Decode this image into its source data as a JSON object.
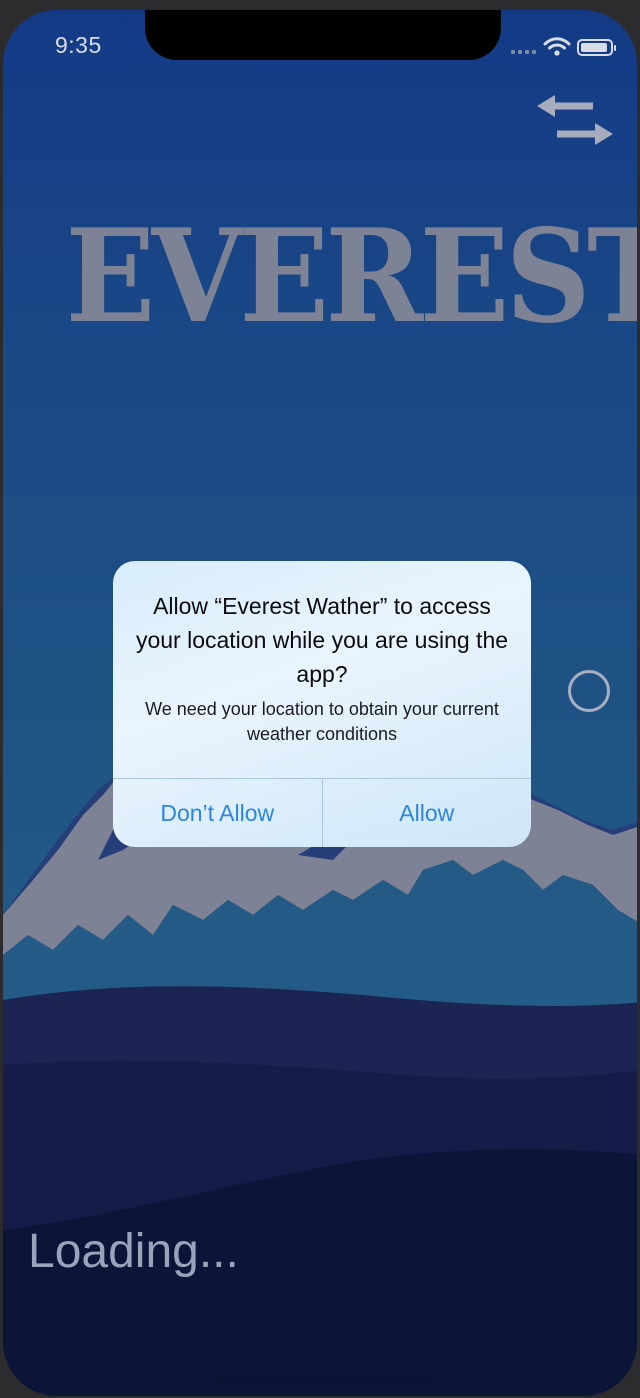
{
  "status_bar": {
    "time": "9:35"
  },
  "app": {
    "logo_text": "EVEREST",
    "loading_text": "Loading...",
    "colors": {
      "background_top": "#143a86",
      "background_bottom": "#255d84",
      "mountain_snow": "#7d8294",
      "hills_front": "#1b2452",
      "hills_back": "#0b1538"
    }
  },
  "icons": {
    "swap": "swap-arrows-icon",
    "spinner": "loading-spinner-icon",
    "wifi": "wifi-icon",
    "battery": "battery-icon"
  },
  "alert": {
    "title": "Allow “Everest Wather” to access your location while you are using the app?",
    "message": "We need your location to obtain your current weather conditions",
    "buttons": {
      "deny_label": "Don’t Allow",
      "allow_label": "Allow"
    },
    "accent_color": "#2a86e0"
  }
}
